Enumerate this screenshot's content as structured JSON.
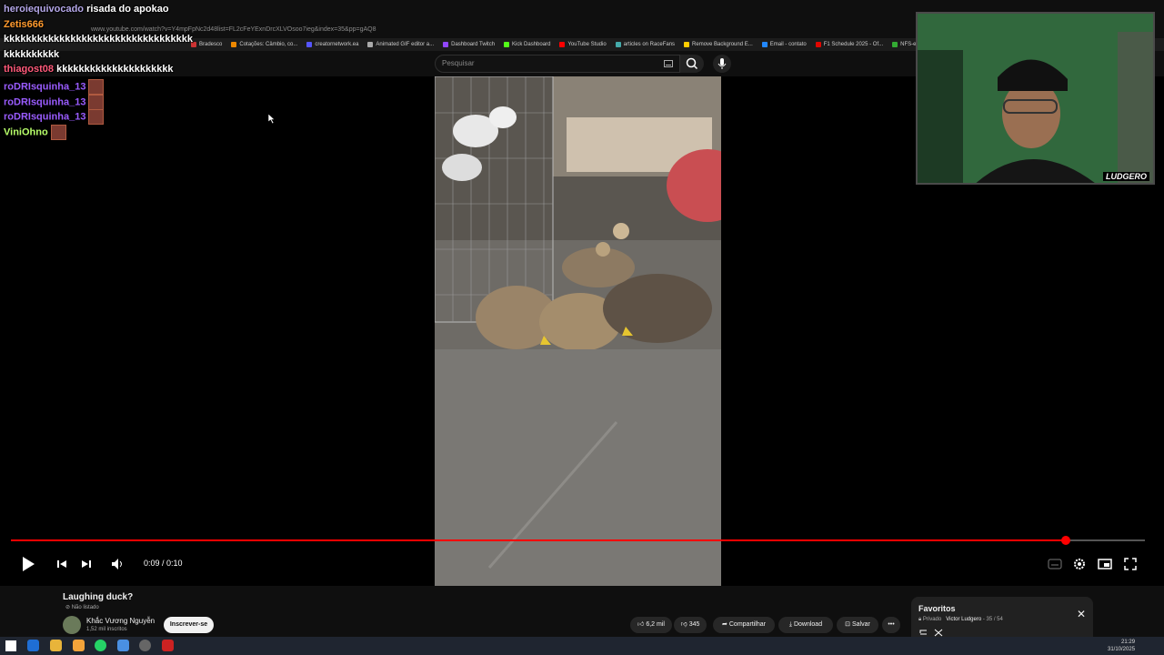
{
  "browser": {
    "url": "www.youtube.com/watch?v=Y4mpFpNc2d48list=FL2cFeYExnDrcXLVOsoo7ieg&index=35&pp=gAQ8",
    "bookmarks": [
      "Bradesco",
      "Cotações: Câmbio, co...",
      "creatornetwork.ea",
      "Animated GIF editor a...",
      "Dashboard Twitch",
      "Kick Dashboard",
      "YouTube Studio",
      "articles on RaceFans",
      "Remove Background E...",
      "Email - contato",
      "F1 Schedule 2025 - Of...",
      "NFS-e | Portal Contr..."
    ]
  },
  "youtube": {
    "search_placeholder": "Pesquisar"
  },
  "chat": [
    {
      "user": "heroiequivocado",
      "msg": "risada do apokao",
      "color": "#b4a7e8"
    },
    {
      "user": "Zetis666",
      "msg": "",
      "color": "#ff9a2e"
    },
    {
      "user": "",
      "msg": "kkkkkkkkkkkkkkkkkkkkkkkkkkkkkkkkkk",
      "color": "#ffffff"
    },
    {
      "user": "",
      "msg": "kkkkkkkkkk",
      "color": "#ffffff"
    },
    {
      "user": "thiagost08",
      "msg": "kkkkkkkkkkkkkkkkkkkkk",
      "color": "#ff5a7a"
    },
    {
      "user": "roDRIsquinha_13",
      "msg": "",
      "color": "#9a5cff"
    },
    {
      "user": "roDRIsquinha_13",
      "msg": "",
      "color": "#9a5cff"
    },
    {
      "user": "roDRIsquinha_13",
      "msg": "",
      "color": "#9a5cff"
    },
    {
      "user": "ViniOhno",
      "msg": "",
      "color": "#b8ff6a"
    }
  ],
  "player": {
    "time": "0:09 / 0:10",
    "progress": 0.93,
    "accent": "#ff0000"
  },
  "video_info": {
    "title": "Laughing duck?",
    "visibility": "Não listado",
    "channel": "Khắc Vương Nguyễn",
    "subscribers": "1,52 mil inscritos",
    "subscribe_label": "Inscrever-se",
    "likes": "6,2 mil",
    "dislikes": "345",
    "share_label": "Compartilhar",
    "download_label": "Download",
    "save_label": "Salvar"
  },
  "favorites": {
    "title": "Favoritos",
    "privacy": "Privado",
    "owner": "Victor Ludgero",
    "position": "35 / 54"
  },
  "webcam": {
    "logo": "LUDGERO"
  },
  "taskbar": {
    "time": "21:29",
    "date": "31/10/2025"
  }
}
